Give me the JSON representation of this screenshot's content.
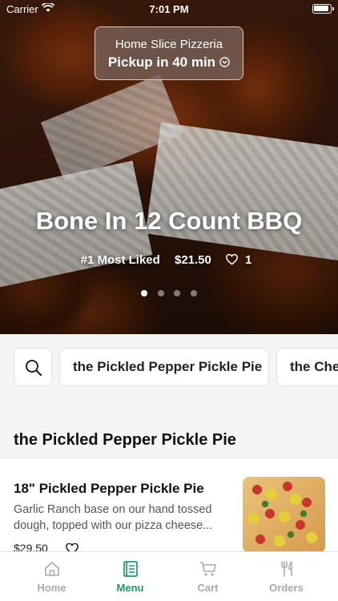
{
  "status_bar": {
    "carrier": "Carrier",
    "time": "7:01 PM"
  },
  "store": {
    "name": "Home Slice Pizzeria",
    "pickup": "Pickup in 40 min"
  },
  "hero": {
    "title": "Bone In 12 Count BBQ",
    "rank": "#1 Most Liked",
    "price": "$21.50",
    "likes": "1",
    "carousel": {
      "count": 4,
      "active": 1
    }
  },
  "categories": [
    {
      "label": "the Pickled Pepper Pickle Pie"
    },
    {
      "label": "the Che"
    }
  ],
  "section": {
    "title": "the Pickled Pepper Pickle Pie"
  },
  "item": {
    "name": "18\" Pickled Pepper Pickle Pie",
    "description": "Garlic Ranch base on our hand tossed dough, topped with our pizza cheese...",
    "price": "$29.50"
  },
  "tabs": [
    {
      "label": "Home",
      "icon": "home-icon",
      "active": false
    },
    {
      "label": "Menu",
      "icon": "menu-icon",
      "active": true
    },
    {
      "label": "Cart",
      "icon": "cart-icon",
      "active": false
    },
    {
      "label": "Orders",
      "icon": "fork-knife-icon",
      "active": false
    }
  ],
  "colors": {
    "accent": "#1a9b6c",
    "inactive_tab": "#a8a8a8"
  }
}
